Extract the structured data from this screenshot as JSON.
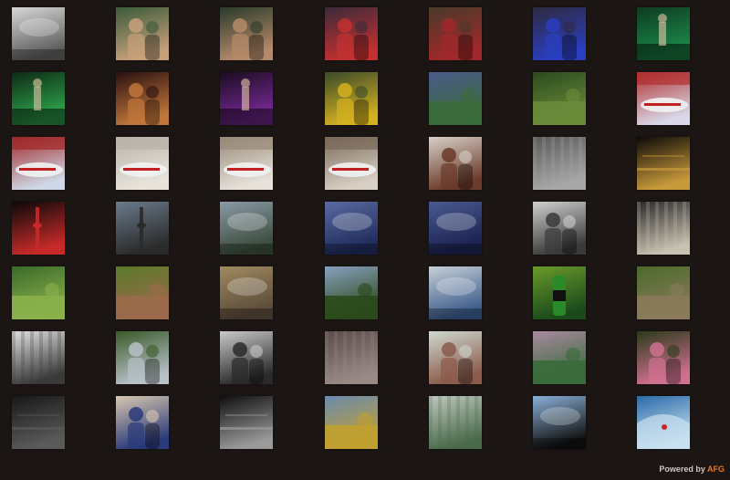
{
  "footer": {
    "label": "Powered by",
    "brand": "AFG",
    "brand_color": "#e07a2a"
  },
  "gallery": {
    "columns": 7,
    "thumbs": [
      {
        "name": "thumb-city-skyline-bw",
        "a": "#d8d8d8",
        "b": "#5a5a5a",
        "kind": "sky"
      },
      {
        "name": "thumb-couple-portrait-1",
        "a": "#3a5a3a",
        "b": "#c7a07a",
        "kind": "people"
      },
      {
        "name": "thumb-couple-portrait-2",
        "a": "#2a3a2a",
        "b": "#b58a6a",
        "kind": "people"
      },
      {
        "name": "thumb-carousel-women-1",
        "a": "#3b2a3a",
        "b": "#c23030",
        "kind": "people"
      },
      {
        "name": "thumb-carousel-women-2",
        "a": "#4a3a2a",
        "b": "#a0282a",
        "kind": "people"
      },
      {
        "name": "thumb-carousel-women-3",
        "a": "#2e2a40",
        "b": "#2a3ec0",
        "kind": "people"
      },
      {
        "name": "thumb-green-stage-musician",
        "a": "#0e3a22",
        "b": "#1c8c4a",
        "kind": "stage"
      },
      {
        "name": "thumb-guitarist-green-light",
        "a": "#0d2a14",
        "b": "#2fa84e",
        "kind": "stage"
      },
      {
        "name": "thumb-guitarist-closeup",
        "a": "#2a1010",
        "b": "#c0763a",
        "kind": "people"
      },
      {
        "name": "thumb-concert-stage-lights",
        "a": "#1a0c20",
        "b": "#7a2a9a",
        "kind": "stage"
      },
      {
        "name": "thumb-graduate-yellow-dress",
        "a": "#3a4a2a",
        "b": "#d4b020",
        "kind": "people"
      },
      {
        "name": "thumb-pond-garden",
        "a": "#4a5a8a",
        "b": "#3a6a3a",
        "kind": "land"
      },
      {
        "name": "thumb-forest-path",
        "a": "#2a4a1e",
        "b": "#6a8a3a",
        "kind": "land"
      },
      {
        "name": "thumb-flag-jet-nose",
        "a": "#b03030",
        "b": "#d8d8e8",
        "kind": "plane"
      },
      {
        "name": "thumb-jet-flag-hangar",
        "a": "#a02828",
        "b": "#cfd8e8",
        "kind": "plane"
      },
      {
        "name": "thumb-plane-hangar-1",
        "a": "#b8b2a8",
        "b": "#e8e4dc",
        "kind": "plane"
      },
      {
        "name": "thumb-plane-hangar-2",
        "a": "#9a8a7a",
        "b": "#e6e2da",
        "kind": "plane"
      },
      {
        "name": "thumb-plane-red-stripe",
        "a": "#7a6a5a",
        "b": "#d8cfc4",
        "kind": "plane"
      },
      {
        "name": "thumb-girl-portrait",
        "a": "#d8d0c8",
        "b": "#6a3a2a",
        "kind": "people"
      },
      {
        "name": "thumb-ice-texture",
        "a": "#5a5a5a",
        "b": "#a8a8a8",
        "kind": "texture"
      },
      {
        "name": "thumb-night-street",
        "a": "#0c0a08",
        "b": "#c89a3a",
        "kind": "night"
      },
      {
        "name": "thumb-cn-tower-night",
        "a": "#0a0808",
        "b": "#c82a2a",
        "kind": "tower"
      },
      {
        "name": "thumb-cn-tower-day",
        "a": "#6a7a8a",
        "b": "#2a2a2a",
        "kind": "tower"
      },
      {
        "name": "thumb-skyscraper-look-up",
        "a": "#8a9aa8",
        "b": "#3a4a3a",
        "kind": "sky"
      },
      {
        "name": "thumb-storm-clouds-1",
        "a": "#5a6aa0",
        "b": "#1e2a5a",
        "kind": "sky"
      },
      {
        "name": "thumb-storm-clouds-2",
        "a": "#4a5a90",
        "b": "#1a2050",
        "kind": "sky"
      },
      {
        "name": "thumb-boy-fedora-bw",
        "a": "#cfcfcf",
        "b": "#3a3a3a",
        "kind": "people"
      },
      {
        "name": "thumb-stadium-crowd",
        "a": "#2a2a2a",
        "b": "#c8c0b0",
        "kind": "texture"
      },
      {
        "name": "thumb-picnic-park",
        "a": "#3a6a2a",
        "b": "#8ab04a",
        "kind": "land"
      },
      {
        "name": "thumb-deer-grazing",
        "a": "#5a7a2a",
        "b": "#9a6a4a",
        "kind": "land"
      },
      {
        "name": "thumb-seagull-lamp",
        "a": "#a08a60",
        "b": "#5a4a3a",
        "kind": "sky"
      },
      {
        "name": "thumb-sunset-field",
        "a": "#8aa0c0",
        "b": "#2a4a1a",
        "kind": "land"
      },
      {
        "name": "thumb-bird-on-wire",
        "a": "#c8d0d8",
        "b": "#3a5a8a",
        "kind": "sky"
      },
      {
        "name": "thumb-green-soda-bottle",
        "a": "#6a9a2a",
        "b": "#1a4a1a",
        "kind": "bottle"
      },
      {
        "name": "thumb-bird-grass",
        "a": "#4a6a2a",
        "b": "#8a7a5a",
        "kind": "land"
      },
      {
        "name": "thumb-building-lines-bw",
        "a": "#e0e0e0",
        "b": "#3a3a3a",
        "kind": "texture"
      },
      {
        "name": "thumb-helmet-stickers",
        "a": "#3a5a2a",
        "b": "#b8c0c8",
        "kind": "people"
      },
      {
        "name": "thumb-woman-face-bw",
        "a": "#cacaca",
        "b": "#2a2a2a",
        "kind": "people"
      },
      {
        "name": "thumb-rose-sepia",
        "a": "#5a4a48",
        "b": "#9a8a86",
        "kind": "texture"
      },
      {
        "name": "thumb-woman-smiling-gym",
        "a": "#cfd8d0",
        "b": "#8a5a4a",
        "kind": "people"
      },
      {
        "name": "thumb-misty-hills",
        "a": "#a88aa0",
        "b": "#3a6a3a",
        "kind": "land"
      },
      {
        "name": "thumb-girl-pink-top",
        "a": "#2a3a1a",
        "b": "#d07090",
        "kind": "people"
      },
      {
        "name": "thumb-bridge-dark",
        "a": "#181818",
        "b": "#5a5a5a",
        "kind": "night"
      },
      {
        "name": "thumb-car-radio-hand",
        "a": "#d8c8b0",
        "b": "#2a3a7a",
        "kind": "people"
      },
      {
        "name": "thumb-microphone-bw",
        "a": "#0e0e0e",
        "b": "#9a9a9a",
        "kind": "night"
      },
      {
        "name": "thumb-wheat-field",
        "a": "#6a8ab0",
        "b": "#c0a030",
        "kind": "land"
      },
      {
        "name": "thumb-leaf-closeup",
        "a": "#c0c8c0",
        "b": "#4a6a4a",
        "kind": "texture"
      },
      {
        "name": "thumb-diver-silhouette",
        "a": "#8ab0d8",
        "b": "#101010",
        "kind": "sky"
      },
      {
        "name": "thumb-surfer-wave",
        "a": "#2a6aa8",
        "b": "#c8e0f0",
        "kind": "sea"
      }
    ]
  }
}
